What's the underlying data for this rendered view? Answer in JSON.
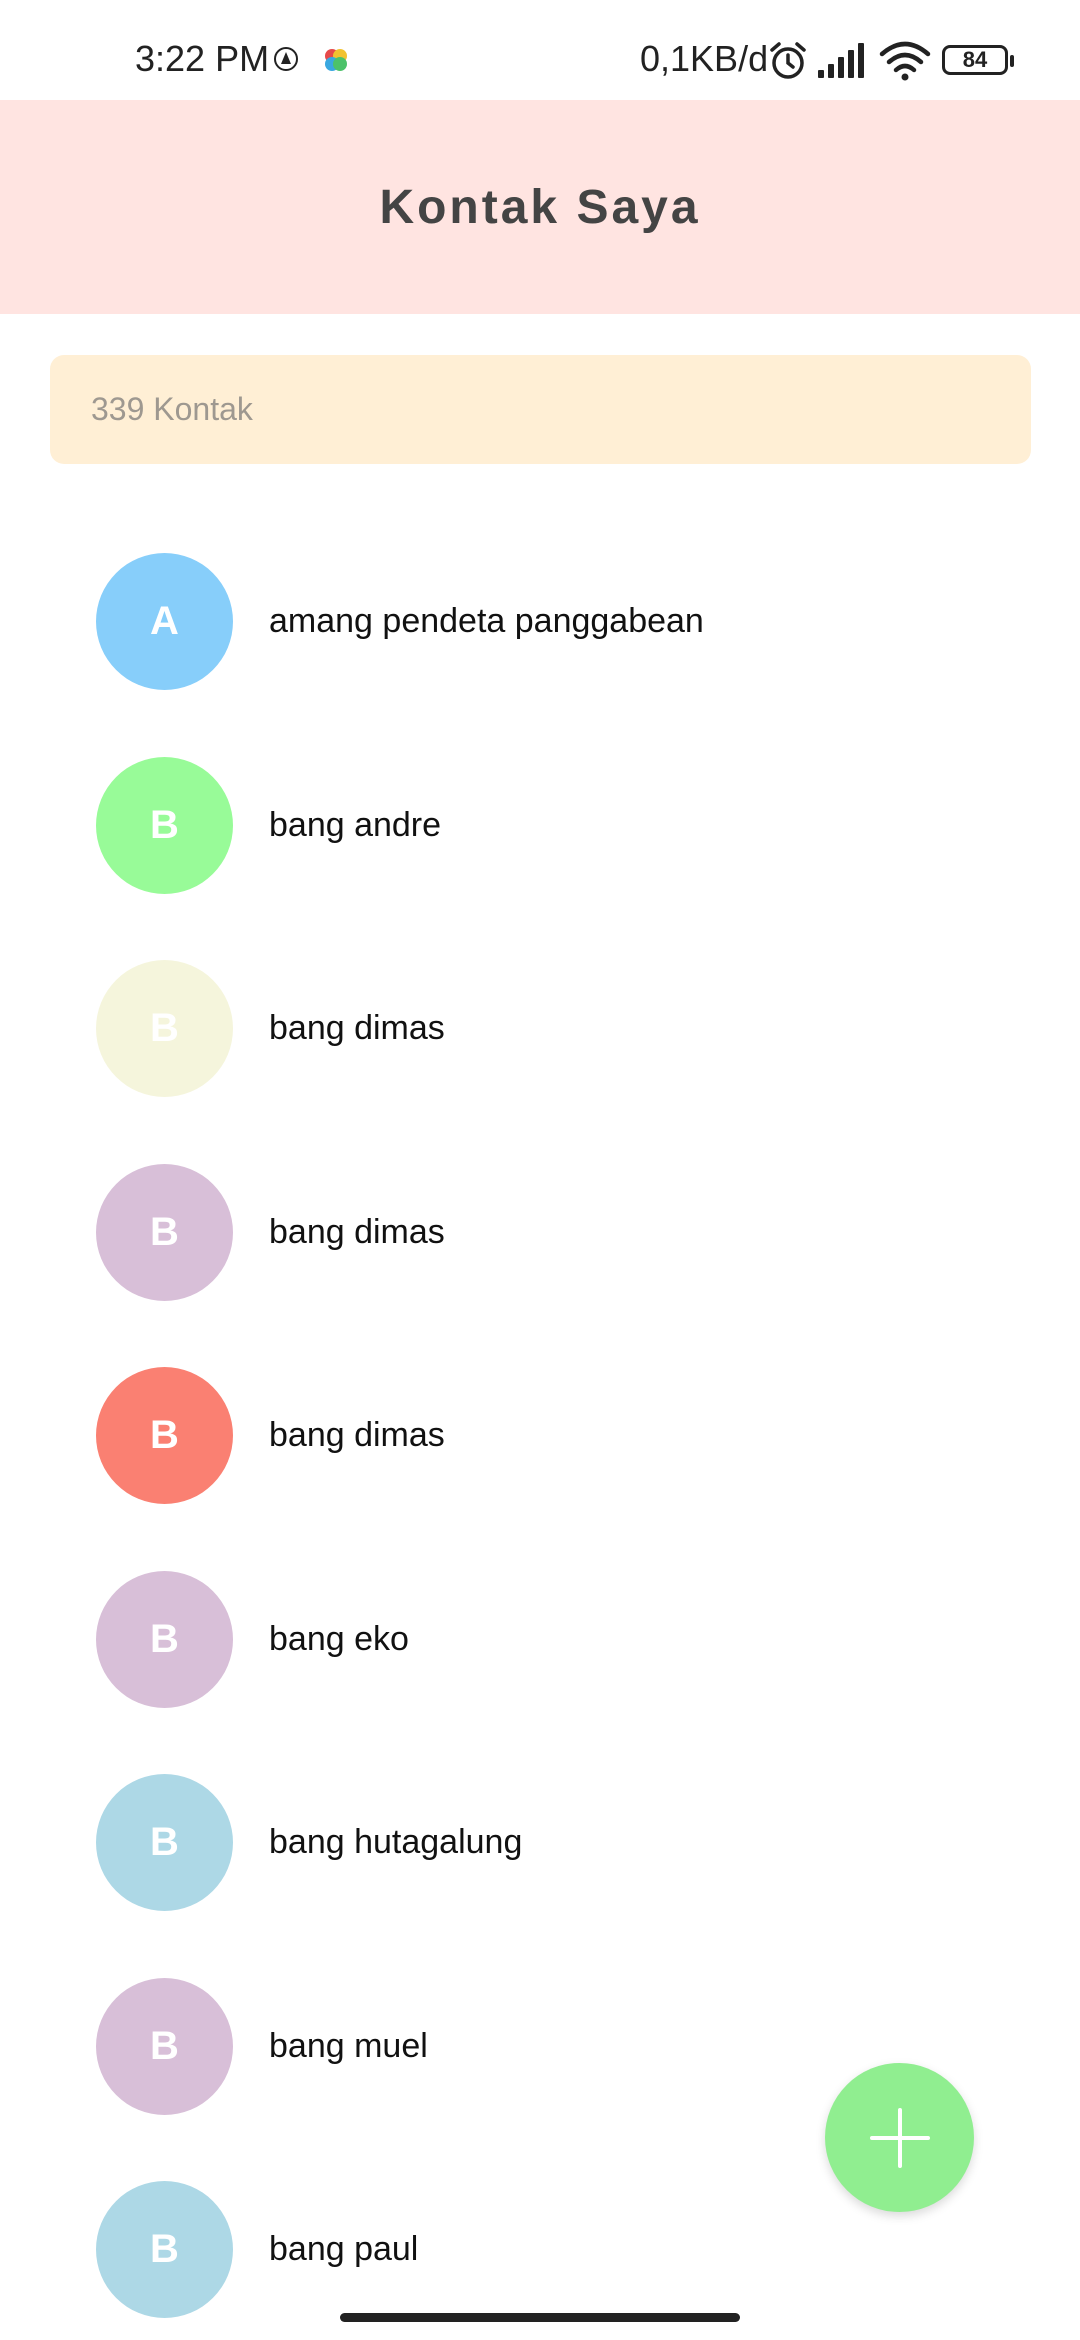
{
  "status_bar": {
    "time": "3:22 PM",
    "network_speed": "0,1KB/d",
    "battery": "84",
    "icons": [
      "app-notification-icon",
      "colorful-app-icon",
      "alarm-icon",
      "signal-icon",
      "wifi-icon",
      "battery-icon"
    ]
  },
  "header": {
    "title": "Kontak Saya",
    "background": "#ffe4e1"
  },
  "count": {
    "label": "339 Kontak",
    "background": "#ffefd5"
  },
  "contacts": [
    {
      "initial": "A",
      "name": "amang pendeta panggabean",
      "color": "#87cefa"
    },
    {
      "initial": "B",
      "name": "bang andre",
      "color": "#98fb98"
    },
    {
      "initial": "B",
      "name": "bang dimas",
      "color": "#f5f5dc"
    },
    {
      "initial": "B",
      "name": "bang dimas",
      "color": "#d8bfd8"
    },
    {
      "initial": "B",
      "name": "bang dimas",
      "color": "#fa8072"
    },
    {
      "initial": "B",
      "name": "bang eko",
      "color": "#d8bfd8"
    },
    {
      "initial": "B",
      "name": "bang hutagalung",
      "color": "#add8e6"
    },
    {
      "initial": "B",
      "name": "bang muel",
      "color": "#d8bfd8"
    },
    {
      "initial": "B",
      "name": "bang paul",
      "color": "#add8e6"
    }
  ],
  "fab": {
    "icon": "plus-icon",
    "color": "#90ee90"
  }
}
